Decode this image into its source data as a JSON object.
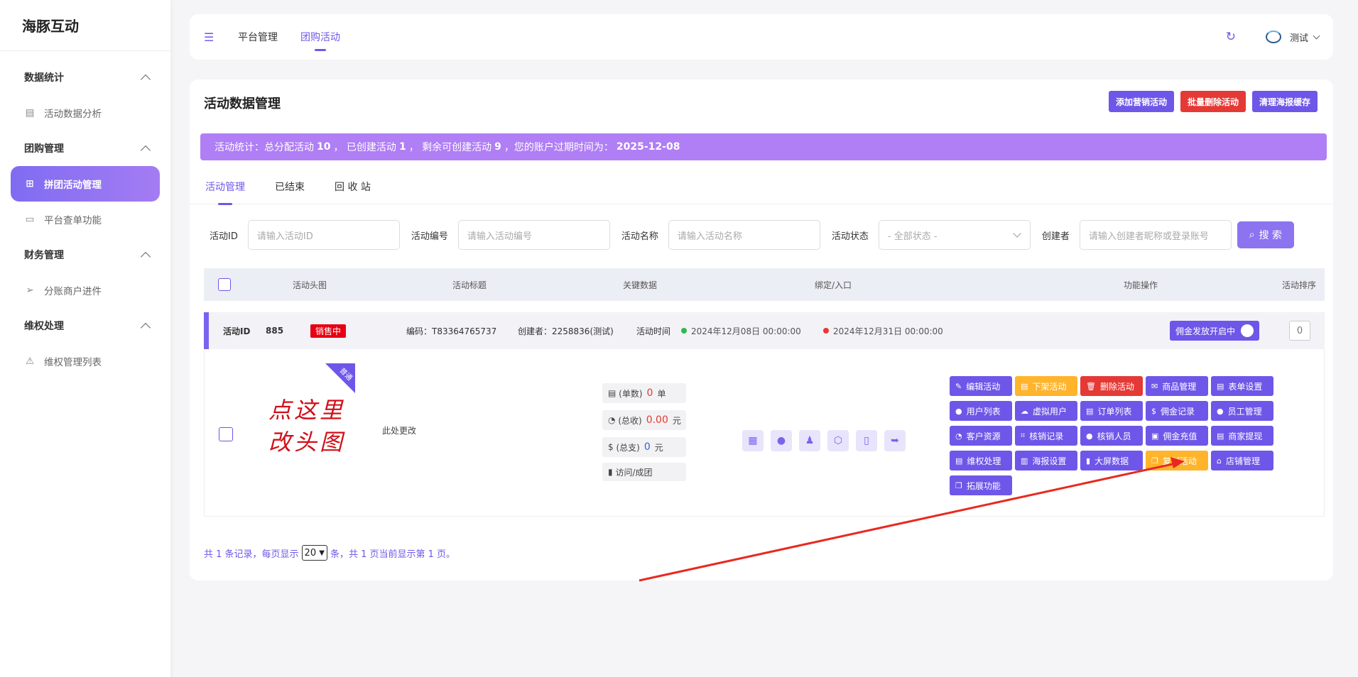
{
  "brand": "海豚互动",
  "sidebar": {
    "groups": [
      {
        "label": "数据统计",
        "items": [
          {
            "label": "活动数据分析"
          }
        ]
      },
      {
        "label": "团购管理",
        "items": [
          {
            "label": "拼团活动管理",
            "active": true
          },
          {
            "label": "平台查单功能"
          }
        ]
      },
      {
        "label": "财务管理",
        "items": [
          {
            "label": "分账商户进件"
          }
        ]
      },
      {
        "label": "维权处理",
        "items": [
          {
            "label": "维权管理列表"
          }
        ]
      }
    ]
  },
  "topbar": {
    "nav": [
      "平台管理",
      "团购活动"
    ],
    "user": "测试"
  },
  "page": {
    "title": "活动数据管理",
    "actions": [
      "添加营销活动",
      "批量删除活动",
      "清理海报缓存"
    ]
  },
  "banner": {
    "prefix": "活动统计：总分配活动",
    "total": "10",
    "sep1": "，  已创建活动",
    "created": "1",
    "sep2": "，  剩余可创建活动",
    "remaining": "9",
    "sep3": "，您的账户过期时间为：",
    "expire": "2025-12-08"
  },
  "tabs": [
    "活动管理",
    "已结束",
    "回 收 站"
  ],
  "filters": {
    "id_label": "活动ID",
    "id_placeholder": "请输入活动ID",
    "code_label": "活动编号",
    "code_placeholder": "请输入活动编号",
    "name_label": "活动名称",
    "name_placeholder": "请输入活动名称",
    "status_label": "活动状态",
    "status_value": "- 全部状态 -",
    "creator_label": "创建者",
    "creator_placeholder": "请输入创建者昵称或登录账号",
    "search_label": "搜 索"
  },
  "table": {
    "headers": [
      "活动头图",
      "活动标题",
      "关键数据",
      "绑定/入口",
      "功能操作",
      "活动排序"
    ]
  },
  "row": {
    "id_label": "活动ID",
    "id": "885",
    "status": "销售中",
    "code": "编码：T83364765737",
    "creator": "创建者：2258836(测试)",
    "time_label": "活动时间",
    "start": "2024年12月08日 00:00:00",
    "end": "2024年12月31日 00:00:00",
    "commission": "佣金发放开启中",
    "sort": "0",
    "cover_line1": "点这里",
    "cover_line2": "改头图",
    "ribbon": "普通",
    "title": "此处更改",
    "kd": [
      {
        "label": "(单数)",
        "value": "0",
        "unit": "单",
        "color": "red"
      },
      {
        "label": "(总收)",
        "value": "0.00",
        "unit": "元",
        "color": "red"
      },
      {
        "label": "(总支)",
        "value": "0",
        "unit": "元",
        "color": "blue"
      },
      {
        "label": "访问/成团",
        "value": "",
        "unit": "",
        "color": ""
      }
    ],
    "ops": [
      {
        "label": "编辑活动",
        "color": "purple",
        "icon": "✎"
      },
      {
        "label": "下架活动",
        "color": "orange",
        "icon": "▤"
      },
      {
        "label": "删除活动",
        "color": "red",
        "icon": "🗑"
      },
      {
        "label": "商品管理",
        "color": "purple",
        "icon": "✉"
      },
      {
        "label": "表单设置",
        "color": "purple",
        "icon": "▤"
      },
      {
        "label": "用户列表",
        "color": "purple",
        "icon": "●"
      },
      {
        "label": "虚拟用户",
        "color": "purple",
        "icon": "☁"
      },
      {
        "label": "订单列表",
        "color": "purple",
        "icon": "▤"
      },
      {
        "label": "佣金记录",
        "color": "purple",
        "icon": "$"
      },
      {
        "label": "员工管理",
        "color": "purple",
        "icon": "●"
      },
      {
        "label": "客户资源",
        "color": "purple",
        "icon": "◔"
      },
      {
        "label": "核销记录",
        "color": "purple",
        "icon": "⌗"
      },
      {
        "label": "核销人员",
        "color": "purple",
        "icon": "●"
      },
      {
        "label": "佣金充值",
        "color": "purple",
        "icon": "▣"
      },
      {
        "label": "商家提现",
        "color": "purple",
        "icon": "▤"
      },
      {
        "label": "维权处理",
        "color": "purple",
        "icon": "▤"
      },
      {
        "label": "海报设置",
        "color": "purple",
        "icon": "▥"
      },
      {
        "label": "大屏数据",
        "color": "purple",
        "icon": "▮"
      },
      {
        "label": "复制活动",
        "color": "orange",
        "icon": "❐"
      },
      {
        "label": "店铺管理",
        "color": "purple",
        "icon": "⌂"
      },
      {
        "label": "拓展功能",
        "color": "purple",
        "icon": "❐"
      }
    ]
  },
  "pager": {
    "prefix": "共 1 条记录，每页显示",
    "size": "20",
    "suffix": "条，共 1 页当前显示第 1 页。"
  }
}
